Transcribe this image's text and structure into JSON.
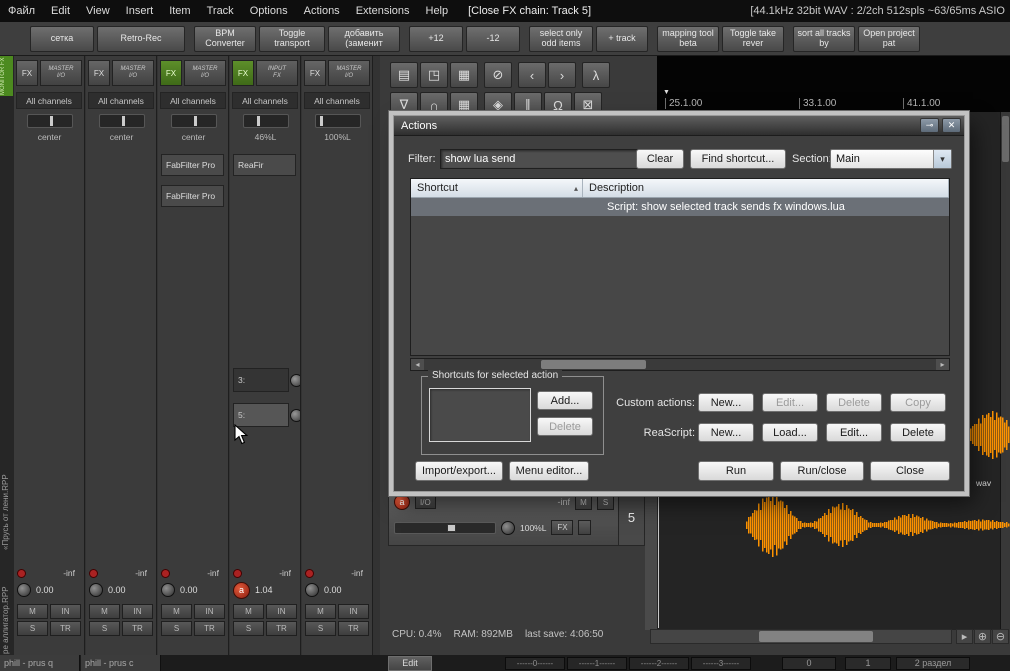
{
  "menubar": {
    "items": [
      "Файл",
      "Edit",
      "View",
      "Insert",
      "Item",
      "Track",
      "Options",
      "Actions",
      "Extensions",
      "Help"
    ],
    "window_title": "[Close FX chain: Track 5]",
    "audio_status": "[44.1kHz 32bit WAV : 2/2ch 512spls ~63/65ms ASIO"
  },
  "toolbar": {
    "buttons": [
      "сетка",
      "Retro-Rec",
      "BPM Converter",
      "Toggle transport",
      "добавить (заменит",
      "+12",
      "-12",
      "select only odd items",
      "+ track",
      "mapping tool beta",
      "Toggle take rever",
      "sort all tracks by",
      "Open project pat"
    ]
  },
  "icons": {
    "row1": [
      "▤",
      "◳",
      "▦",
      "⊘",
      "‹",
      "›",
      "λ"
    ],
    "row2": [
      "∇",
      "∩",
      "▦",
      "◈",
      "∥",
      "Ω",
      "⊠"
    ],
    "caret_down": "▾",
    "sort_asc": "▴",
    "scroll_left": "◂",
    "scroll_right": "▸",
    "pin": "⊸",
    "close": "✕",
    "zoom_in": "⊕",
    "zoom_out": "⊖",
    "play_right": "▸",
    "flag": "▼"
  },
  "tabs": {
    "monitor": "MONITOR FX",
    "vertical": [
      "«Прусь от лени.RPP",
      "ре аллигатор.RPP"
    ],
    "bottom": [
      "phill - prus q",
      "phill - prus c"
    ]
  },
  "mixer": {
    "btn_m": "M",
    "btn_s": "S",
    "btn_in": "IN",
    "btn_tr": "TR",
    "strips": [
      {
        "fx": "FX",
        "io1": "MASTER",
        "io2": "I/O",
        "channels": "All channels",
        "pan": "center",
        "gain": "-inf",
        "vol": "0.00"
      },
      {
        "fx": "FX",
        "io1": "MASTER",
        "io2": "I/O",
        "channels": "All channels",
        "pan": "center",
        "gain": "-inf",
        "vol": "0.00"
      },
      {
        "fx": "FX",
        "io1": "MASTER",
        "io2": "I/O",
        "channels": "All channels",
        "pan": "center",
        "gain": "-inf",
        "vol": "0.00",
        "inserts": [
          "FabFilter Pro",
          "FabFilter Pro"
        ]
      },
      {
        "fx": "FX",
        "io1": "INPUT",
        "io2": "FX",
        "channels": "All channels",
        "pan": "46%L",
        "gain": "-inf",
        "vol": "1.04",
        "rec": "a",
        "inserts": [
          "ReaFir"
        ],
        "sends": [
          "3:",
          "5:"
        ]
      },
      {
        "fx": "FX",
        "io1": "MASTER",
        "io2": "I/O",
        "channels": "All channels",
        "pan": "100%L",
        "gain": "-inf",
        "vol": "0.00"
      }
    ]
  },
  "timeline": {
    "markers": [
      "25.1.00",
      "33.1.00",
      "41.1.00"
    ]
  },
  "trackpanel": {
    "rec": "a",
    "io": "I/O",
    "gain": "-inf",
    "mute": "M",
    "solo": "S",
    "pan": "100%L",
    "fx": "FX",
    "number": "5",
    "clip_label": "wav"
  },
  "dialog": {
    "title": "Actions",
    "filter_label": "Filter:",
    "filter_value": "show lua send",
    "clear": "Clear",
    "find_shortcut": "Find shortcut...",
    "section_label": "Section:",
    "section_value": "Main",
    "col_shortcut": "Shortcut",
    "col_description": "Description",
    "selected_row": "Script: show selected track sends fx windows.lua",
    "shortcuts_group": "Shortcuts for selected action",
    "add": "Add...",
    "delete": "Delete",
    "custom_actions_label": "Custom actions:",
    "custom_new": "New...",
    "custom_edit": "Edit...",
    "custom_delete": "Delete",
    "custom_copy": "Copy",
    "reascript_label": "ReaScript:",
    "rs_new": "New...",
    "rs_load": "Load...",
    "rs_edit": "Edit...",
    "rs_delete": "Delete",
    "import_export": "Import/export...",
    "menu_editor": "Menu editor...",
    "run": "Run",
    "run_close": "Run/close",
    "close": "Close"
  },
  "status": {
    "cpu": "CPU: 0.4%",
    "ram": "RAM: 892MB",
    "last_save": "last save: 4:06:50"
  },
  "bottombar": {
    "edit": "Edit",
    "fields": [
      "------0------",
      "------1------",
      "------2------",
      "------3------"
    ],
    "counters": [
      "0",
      "1",
      "2 раздел"
    ]
  }
}
